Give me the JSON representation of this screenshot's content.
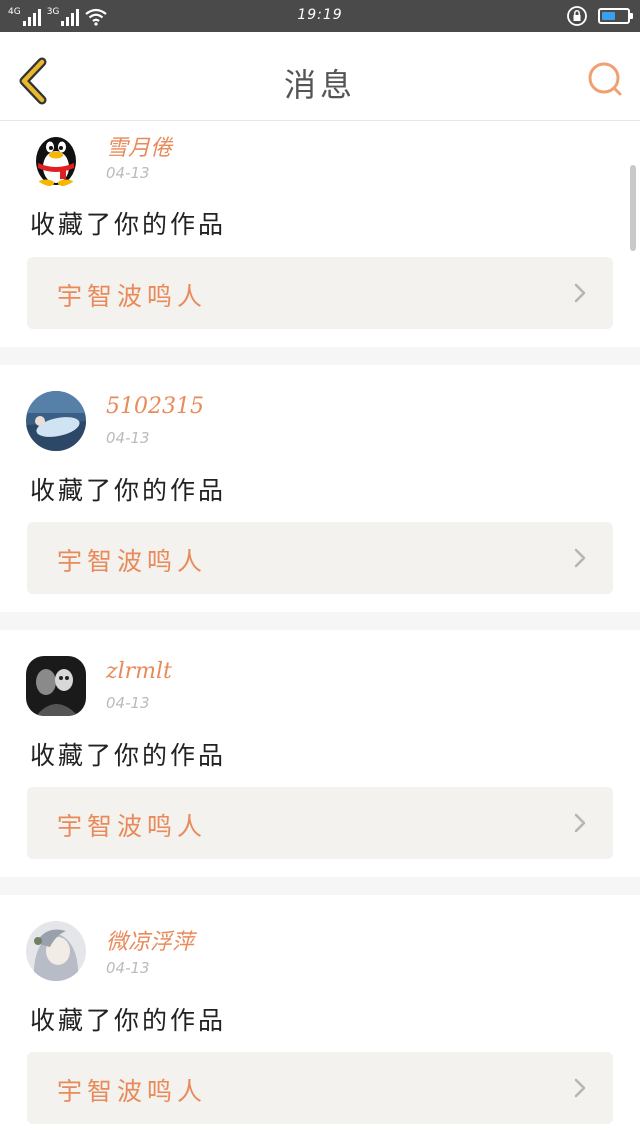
{
  "status_bar": {
    "net1": "4G",
    "net2": "3G",
    "time": "19:19",
    "battery_level": 0.55,
    "battery_color": "#3a9ff0"
  },
  "header": {
    "title": "消息",
    "back_icon": "chevron-left-icon",
    "search_icon": "search-icon"
  },
  "colors": {
    "accent": "#e98a5a",
    "back_icon": "#e8b92e",
    "card_link_bg": "#f3f2ee",
    "divider": "#f6f6f6"
  },
  "messages": [
    {
      "user": "雪月倦",
      "date": "04-13",
      "text": "收藏了你的作品",
      "work": "宇智波鸣人",
      "avatar": "penguin-avatar"
    },
    {
      "user": "5102315",
      "date": "04-13",
      "text": "收藏了你的作品",
      "work": "宇智波鸣人",
      "avatar": "photo-avatar-blue"
    },
    {
      "user": "zlrmlt",
      "date": "04-13",
      "text": "收藏了你的作品",
      "work": "宇智波鸣人",
      "avatar": "photo-avatar-bw"
    },
    {
      "user": "微凉浮萍",
      "date": "04-13",
      "text": "收藏了你的作品",
      "work": "宇智波鸣人",
      "avatar": "photo-avatar-anime"
    }
  ]
}
